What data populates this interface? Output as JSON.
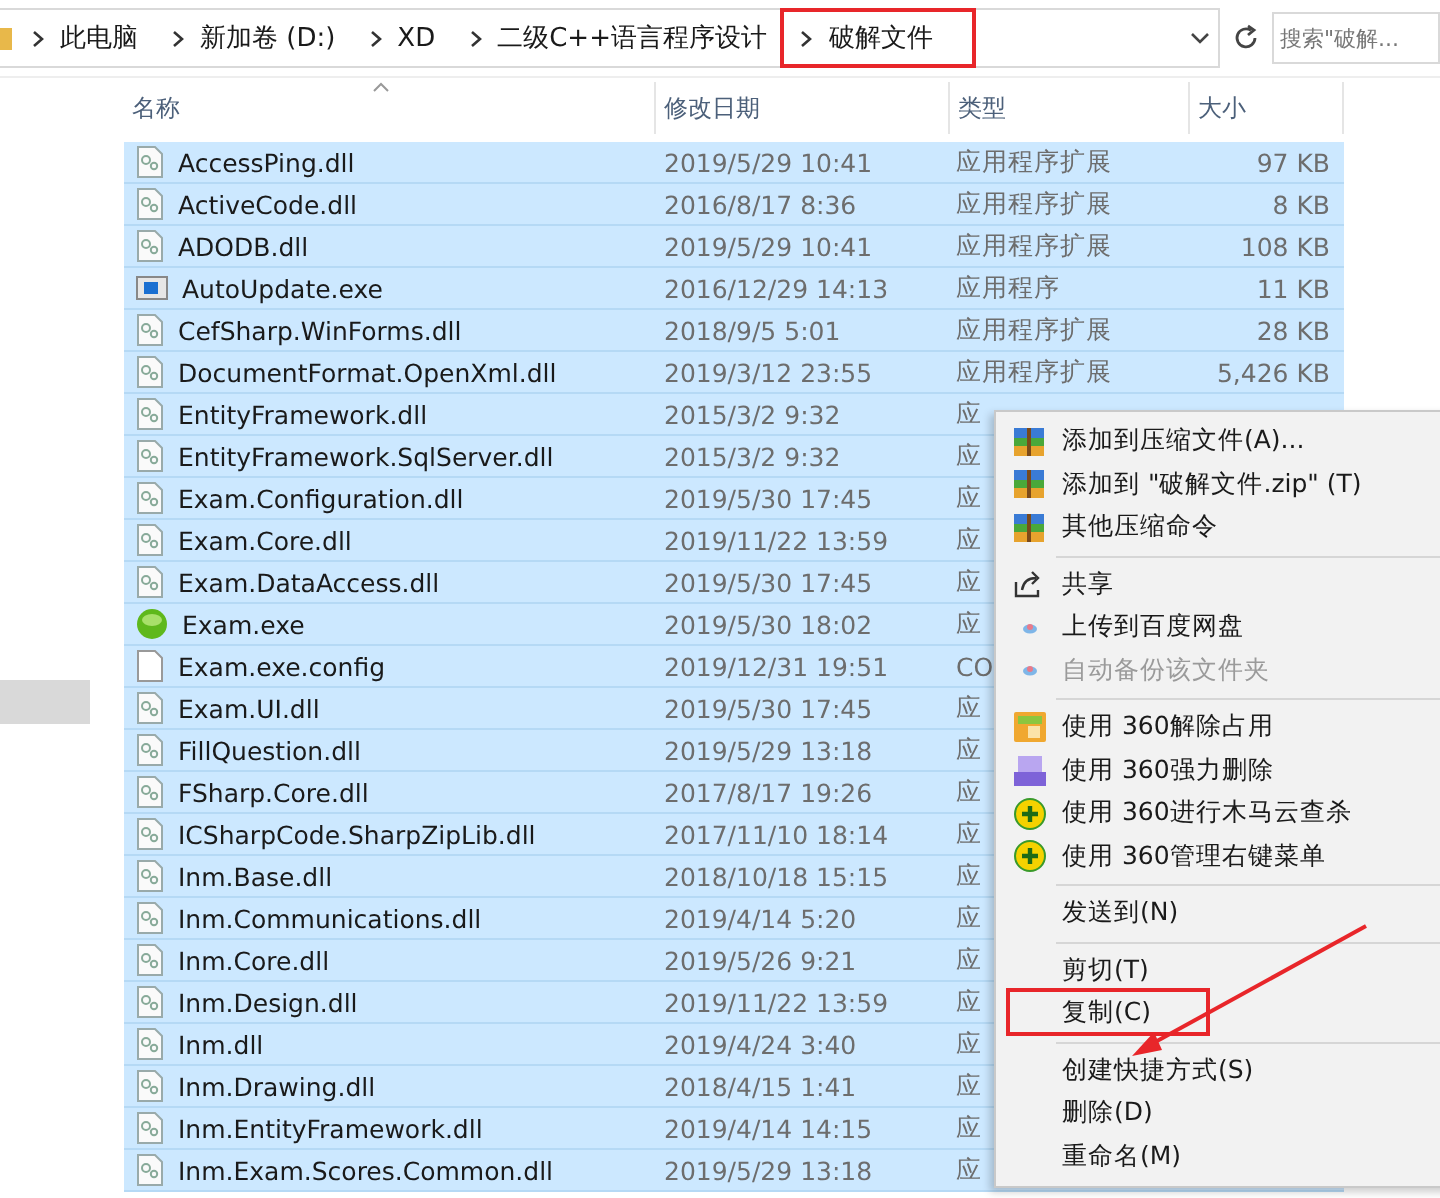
{
  "breadcrumbs": [
    {
      "label": "此电脑",
      "highlighted": false
    },
    {
      "label": "新加卷 (D:)",
      "highlighted": false
    },
    {
      "label": "XD",
      "highlighted": false
    },
    {
      "label": "二级C++语言程序设计",
      "highlighted": false
    },
    {
      "label": "破解文件",
      "highlighted": true
    }
  ],
  "search": {
    "placeholder": "搜索\"破解..."
  },
  "columns": [
    "名称",
    "修改日期",
    "类型",
    "大小"
  ],
  "files": [
    {
      "name": "AccessPing.dll",
      "date": "2019/5/29 10:41",
      "type": "应用程序扩展",
      "size": "97 KB",
      "kind": "dll",
      "selected": true
    },
    {
      "name": "ActiveCode.dll",
      "date": "2016/8/17 8:36",
      "type": "应用程序扩展",
      "size": "8 KB",
      "kind": "dll",
      "selected": true
    },
    {
      "name": "ADODB.dll",
      "date": "2019/5/29 10:41",
      "type": "应用程序扩展",
      "size": "108 KB",
      "kind": "dll",
      "selected": true
    },
    {
      "name": "AutoUpdate.exe",
      "date": "2016/12/29 14:13",
      "type": "应用程序",
      "size": "11 KB",
      "kind": "window",
      "selected": true
    },
    {
      "name": "CefSharp.WinForms.dll",
      "date": "2018/9/5 5:01",
      "type": "应用程序扩展",
      "size": "28 KB",
      "kind": "dll",
      "selected": true
    },
    {
      "name": "DocumentFormat.OpenXml.dll",
      "date": "2019/3/12 23:55",
      "type": "应用程序扩展",
      "size": "5,426 KB",
      "kind": "dll",
      "selected": true
    },
    {
      "name": "EntityFramework.dll",
      "date": "2015/3/2 9:32",
      "type": "应",
      "kind": "dll",
      "selected": true
    },
    {
      "name": "EntityFramework.SqlServer.dll",
      "date": "2015/3/2 9:32",
      "type": "应",
      "kind": "dll",
      "selected": true
    },
    {
      "name": "Exam.Configuration.dll",
      "date": "2019/5/30 17:45",
      "type": "应",
      "kind": "dll",
      "selected": true
    },
    {
      "name": "Exam.Core.dll",
      "date": "2019/11/22 13:59",
      "type": "应",
      "kind": "dll",
      "selected": true
    },
    {
      "name": "Exam.DataAccess.dll",
      "date": "2019/5/30 17:45",
      "type": "应",
      "kind": "dll",
      "selected": true
    },
    {
      "name": "Exam.exe",
      "date": "2019/5/30 18:02",
      "type": "应",
      "kind": "green",
      "selected": true
    },
    {
      "name": "Exam.exe.config",
      "date": "2019/12/31 19:51",
      "type": "CO",
      "kind": "blank",
      "selected": true
    },
    {
      "name": "Exam.UI.dll",
      "date": "2019/5/30 17:45",
      "type": "应",
      "kind": "dll",
      "selected": true
    },
    {
      "name": "FillQuestion.dll",
      "date": "2019/5/29 13:18",
      "type": "应",
      "kind": "dll",
      "selected": true
    },
    {
      "name": "FSharp.Core.dll",
      "date": "2017/8/17 19:26",
      "type": "应",
      "kind": "dll",
      "selected": true
    },
    {
      "name": "ICSharpCode.SharpZipLib.dll",
      "date": "2017/11/10 18:14",
      "type": "应",
      "kind": "dll",
      "selected": true
    },
    {
      "name": "Inm.Base.dll",
      "date": "2018/10/18 15:15",
      "type": "应",
      "kind": "dll",
      "selected": true
    },
    {
      "name": "Inm.Communications.dll",
      "date": "2019/4/14 5:20",
      "type": "应",
      "kind": "dll",
      "selected": true
    },
    {
      "name": "Inm.Core.dll",
      "date": "2019/5/26 9:21",
      "type": "应",
      "kind": "dll",
      "selected": true
    },
    {
      "name": "Inm.Design.dll",
      "date": "2019/11/22 13:59",
      "type": "应",
      "kind": "dll",
      "selected": true
    },
    {
      "name": "Inm.dll",
      "date": "2019/4/24 3:40",
      "type": "应",
      "kind": "dll",
      "selected": true
    },
    {
      "name": "Inm.Drawing.dll",
      "date": "2018/4/15 1:41",
      "type": "应",
      "kind": "dll",
      "selected": true
    },
    {
      "name": "Inm.EntityFramework.dll",
      "date": "2019/4/14 14:15",
      "type": "应",
      "kind": "dll",
      "selected": true
    },
    {
      "name": "Inm.Exam.Scores.Common.dll",
      "date": "2019/5/29 13:18",
      "type": "应",
      "kind": "dll",
      "selected": true
    }
  ],
  "context_menu": [
    {
      "kind": "archive",
      "label": "添加到压缩文件(A)...",
      "disabled": false,
      "highlighted": false
    },
    {
      "kind": "archive",
      "label": "添加到 \"破解文件.zip\" (T)",
      "disabled": false,
      "highlighted": false
    },
    {
      "kind": "archive",
      "label": "其他压缩命令",
      "disabled": false,
      "highlighted": false
    },
    {
      "kind": "separator"
    },
    {
      "kind": "share",
      "label": "共享",
      "disabled": false,
      "highlighted": false
    },
    {
      "kind": "cloud",
      "label": "上传到百度网盘",
      "disabled": false,
      "highlighted": false
    },
    {
      "kind": "cloud",
      "label": "自动备份该文件夹",
      "disabled": true,
      "highlighted": false
    },
    {
      "kind": "separator"
    },
    {
      "kind": "unlock",
      "label": "使用 360解除占用",
      "disabled": false,
      "highlighted": false
    },
    {
      "kind": "shredder",
      "label": "使用 360强力删除",
      "disabled": false,
      "highlighted": false
    },
    {
      "kind": "plus",
      "label": "使用 360进行木马云查杀",
      "disabled": false,
      "highlighted": false
    },
    {
      "kind": "plus",
      "label": "使用 360管理右键菜单",
      "disabled": false,
      "highlighted": false
    },
    {
      "kind": "separator"
    },
    {
      "kind": "plain",
      "label": "发送到(N)",
      "disabled": false,
      "highlighted": false
    },
    {
      "kind": "separator"
    },
    {
      "kind": "plain",
      "label": "剪切(T)",
      "disabled": false,
      "highlighted": false
    },
    {
      "kind": "plain",
      "label": "复制(C)",
      "disabled": false,
      "highlighted": true
    },
    {
      "kind": "separator"
    },
    {
      "kind": "plain",
      "label": "创建快捷方式(S)",
      "disabled": false,
      "highlighted": false
    },
    {
      "kind": "plain",
      "label": "删除(D)",
      "disabled": false,
      "highlighted": false
    },
    {
      "kind": "plain",
      "label": "重命名(M)",
      "disabled": false,
      "highlighted": false
    }
  ]
}
